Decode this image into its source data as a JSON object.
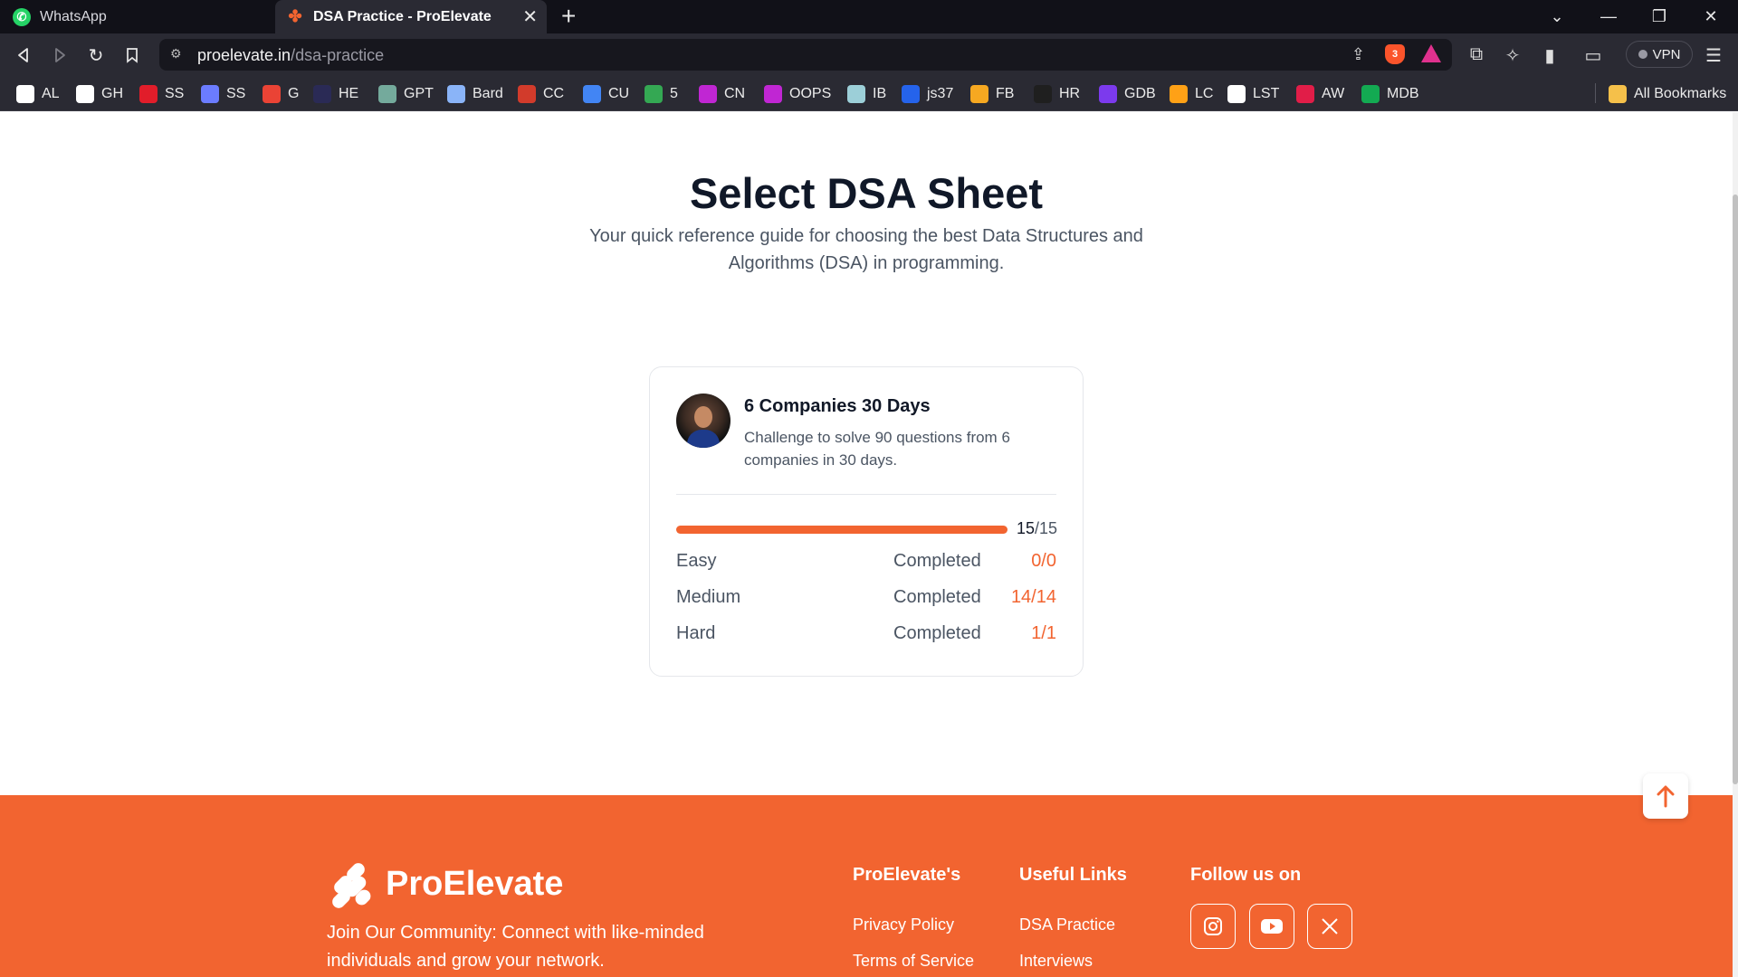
{
  "browser": {
    "tabs": [
      {
        "title": "WhatsApp",
        "active": false,
        "icon": "whatsapp-icon"
      },
      {
        "title": "DSA Practice - ProElevate",
        "active": true,
        "icon": "proelevate-icon"
      }
    ],
    "url_domain": "proelevate.in",
    "url_path": "/dsa-practice",
    "brave_badge": "3",
    "vpn_label": "VPN",
    "bookmarks": [
      {
        "label": "AL",
        "icon": "w-icon",
        "color": "#ffffff"
      },
      {
        "label": "GH",
        "icon": "github-icon",
        "color": "#ffffff"
      },
      {
        "label": "SS",
        "icon": "tuf-icon",
        "color": "#e11d2a"
      },
      {
        "label": "SS",
        "icon": "striver-icon",
        "color": "#6b7cff"
      },
      {
        "label": "G",
        "icon": "gmail-icon",
        "color": "#ea4335"
      },
      {
        "label": "HE",
        "icon": "hackerearth-icon",
        "color": "#2a2a55"
      },
      {
        "label": "GPT",
        "icon": "chatgpt-icon",
        "color": "#74aa9c"
      },
      {
        "label": "Bard",
        "icon": "bard-icon",
        "color": "#8ab4f8"
      },
      {
        "label": "CC",
        "icon": "codechef-icon",
        "color": "#d23b2b"
      },
      {
        "label": "CU",
        "icon": "cu-icon",
        "color": "#4285f4"
      },
      {
        "label": "5",
        "icon": "drive-icon",
        "color": "#34a853"
      },
      {
        "label": "CN",
        "icon": "codingninjas-icon",
        "color": "#c026d3"
      },
      {
        "label": "OOPS",
        "icon": "oops-icon",
        "color": "#c026d3"
      },
      {
        "label": "IB",
        "icon": "interviewbit-icon",
        "color": "#9ccfd8"
      },
      {
        "label": "js37",
        "icon": "js-icon",
        "color": "#2563eb"
      },
      {
        "label": "FB",
        "icon": "firebase-icon",
        "color": "#f6a821"
      },
      {
        "label": "HR",
        "icon": "hackerrank-icon",
        "color": "#1f1f1f"
      },
      {
        "label": "GDB",
        "icon": "gdb-icon",
        "color": "#7c3aed"
      },
      {
        "label": "LC",
        "icon": "leetcode-icon",
        "color": "#ffa116"
      },
      {
        "label": "LST",
        "icon": "github-icon",
        "color": "#ffffff"
      },
      {
        "label": "AW",
        "icon": "aw-icon",
        "color": "#e11d48"
      },
      {
        "label": "MDB",
        "icon": "mongodb-icon",
        "color": "#13aa52"
      }
    ],
    "all_bookmarks_label": "All Bookmarks"
  },
  "page": {
    "title": "Select DSA Sheet",
    "subtitle": "Your quick reference guide for choosing the best Data Structures and Algorithms (DSA) in programming."
  },
  "sheet_card": {
    "title": "6 Companies 30 Days",
    "description": "Challenge to solve 90 questions from 6 companies in 30 days.",
    "progress": {
      "solved": "15",
      "total": "/15",
      "fraction": 1.0
    },
    "rows": [
      {
        "difficulty": "Easy",
        "status": "Completed",
        "value": "0/0"
      },
      {
        "difficulty": "Medium",
        "status": "Completed",
        "value": "14/14"
      },
      {
        "difficulty": "Hard",
        "status": "Completed",
        "value": "1/1"
      }
    ]
  },
  "footer": {
    "brand": "ProElevate",
    "community_text": "Join Our Community: Connect with like-minded individuals and grow your network.",
    "columns": [
      {
        "title": "ProElevate's",
        "links": [
          "Privacy Policy",
          "Terms of Service"
        ]
      },
      {
        "title": "Useful Links",
        "links": [
          "DSA Practice",
          "Interviews"
        ]
      }
    ],
    "follow_title": "Follow us on",
    "socials": [
      "instagram-icon",
      "youtube-icon",
      "x-icon"
    ]
  },
  "colors": {
    "accent": "#f26430",
    "heading": "#101828",
    "body_text": "#4b5563"
  }
}
